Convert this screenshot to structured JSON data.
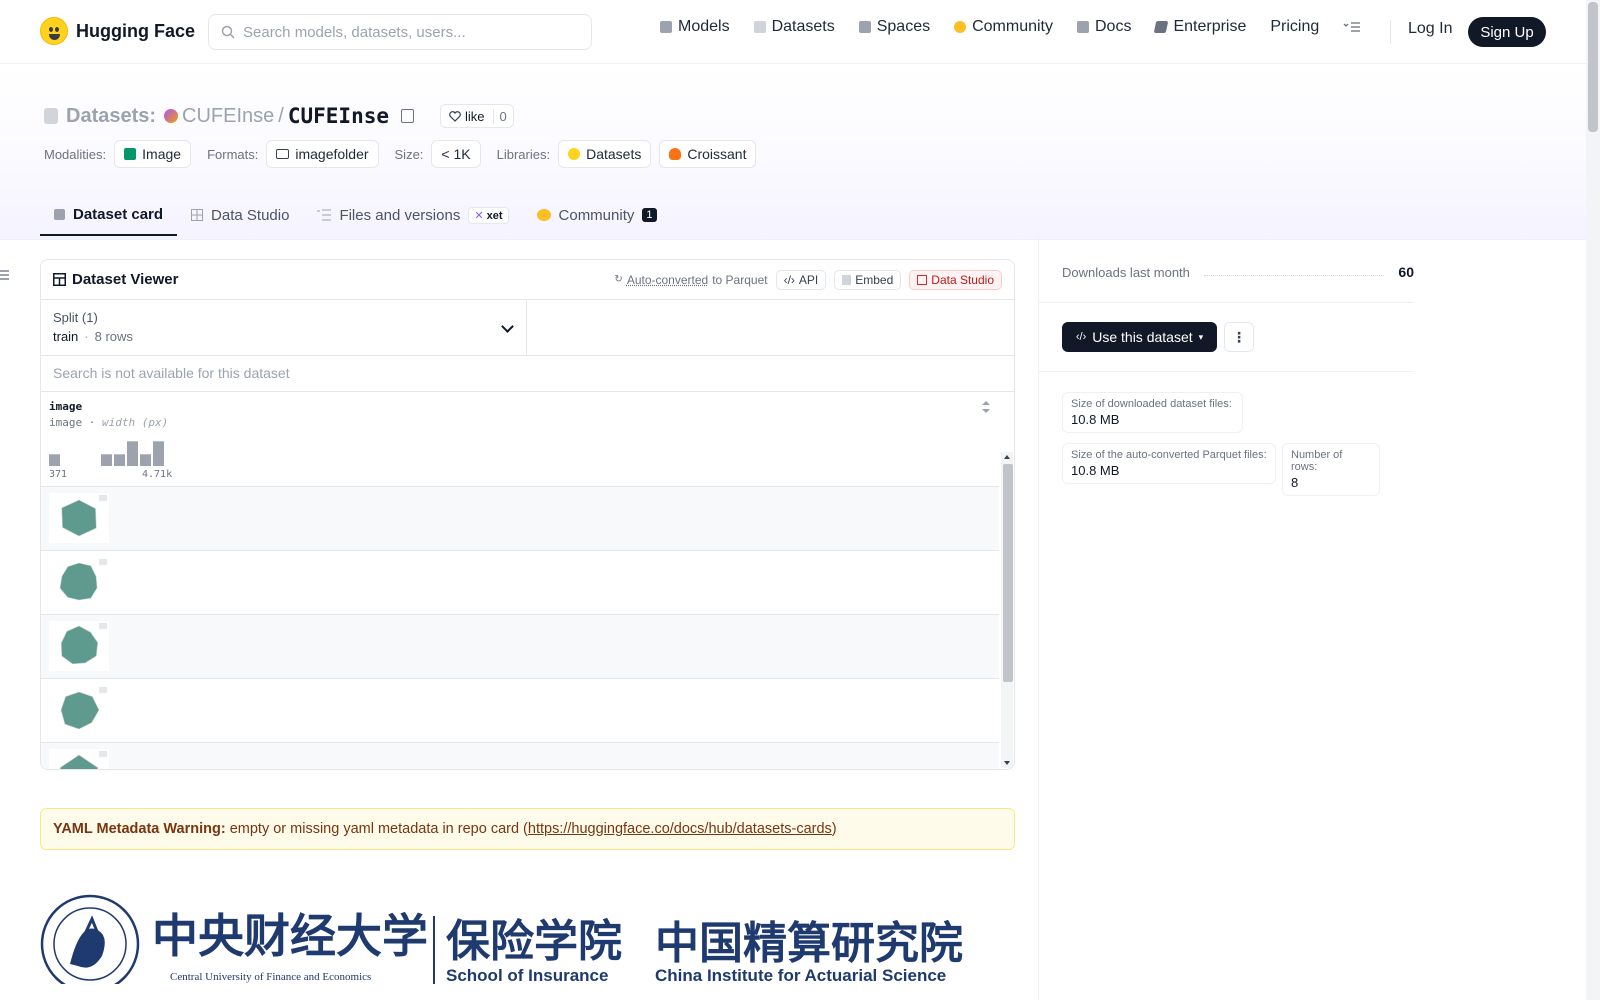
{
  "header": {
    "brand": "Hugging Face",
    "search_placeholder": "Search models, datasets, users...",
    "nav": [
      {
        "label": "Models",
        "icon": "models-icon",
        "color": "#9ca3af"
      },
      {
        "label": "Datasets",
        "icon": "datasets-icon",
        "color": "#d1d5db"
      },
      {
        "label": "Spaces",
        "icon": "spaces-icon",
        "color": "#9ca3af"
      },
      {
        "label": "Community",
        "icon": "community-icon",
        "color": "#fbbf24"
      },
      {
        "label": "Docs",
        "icon": "docs-icon",
        "color": "#9ca3af"
      },
      {
        "label": "Enterprise",
        "icon": "enterprise-icon",
        "color": "#6b7280"
      },
      {
        "label": "Pricing",
        "icon": "",
        "color": ""
      }
    ],
    "login": "Log In",
    "signup": "Sign Up"
  },
  "repo": {
    "type_label": "Datasets:",
    "owner": "CUFEInse",
    "slash": "/",
    "name": "CUFEInse",
    "like_label": "like",
    "like_count": "0"
  },
  "meta": {
    "modalities_label": "Modalities:",
    "modality": "Image",
    "formats_label": "Formats:",
    "format": "imagefolder",
    "size_label": "Size:",
    "size": "< 1K",
    "libraries_label": "Libraries:",
    "libraries": [
      "Datasets",
      "Croissant"
    ]
  },
  "tabs": [
    {
      "label": "Dataset card",
      "active": true
    },
    {
      "label": "Data Studio"
    },
    {
      "label": "Files and versions",
      "badge": "xet"
    },
    {
      "label": "Community",
      "count": "1"
    }
  ],
  "viewer": {
    "title": "Dataset Viewer",
    "auto_converted": "Auto-converted",
    "to_parquet": "to Parquet",
    "api": "API",
    "embed": "Embed",
    "data_studio": "Data Studio",
    "split_label": "Split (1)",
    "split_value": "train",
    "split_rows": "8 rows",
    "search_disabled": "Search is not available for this dataset",
    "column_name": "image",
    "column_type": "image",
    "column_stat": "width (px)",
    "hist_min": "371",
    "hist_max": "4.71k",
    "hist_bins": [
      0.45,
      0,
      0,
      0,
      0.45,
      0.45,
      0.95,
      0.45,
      0.95
    ],
    "row_count_visible": 5
  },
  "yaml_warning": {
    "label": "YAML Metadata Warning:",
    "text": "empty or missing yaml metadata in repo card (",
    "link": "https://huggingface.co/docs/hub/datasets-cards",
    "close": ")"
  },
  "banner": {
    "cn_university": "中央财经大学",
    "cn_school": "保险学院",
    "cn_institute": "中国精算研究院",
    "en_university": "Central University of Finance and Economics",
    "en_school": "School of Insurance",
    "en_institute": "China Institute for Actuarial Science",
    "seal_text": "CENTRAL UNIVERSITY OF FINANCE AND ECONOMICS"
  },
  "sidebar": {
    "downloads_label": "Downloads last month",
    "downloads": "60",
    "use_dataset": "Use this dataset",
    "stats": [
      {
        "k": "Size of downloaded dataset files:",
        "v": "10.8 MB"
      },
      {
        "k": "Size of the auto-converted Parquet files:",
        "v": "10.8 MB"
      },
      {
        "k": "Number of rows:",
        "v": "8"
      }
    ]
  }
}
